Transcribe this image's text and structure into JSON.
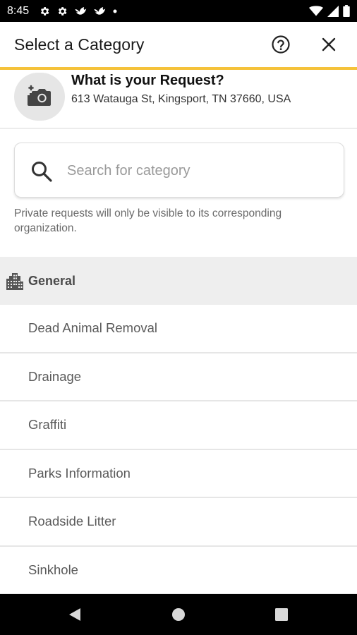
{
  "status_bar": {
    "time": "8:45",
    "left_icons": [
      "gear-icon",
      "gear-icon",
      "bird-icon",
      "bird-icon",
      "dot-icon"
    ],
    "right_icons": [
      "wifi-icon",
      "signal-icon",
      "battery-icon"
    ]
  },
  "header": {
    "title": "Select a Category",
    "help_icon": "help-circle-icon",
    "close_icon": "close-icon",
    "accent_color": "#f5c23a"
  },
  "request": {
    "title": "What is your Request?",
    "address": "613 Watauga St, Kingsport, TN 37660, USA",
    "photo_icon": "add-photo-icon"
  },
  "search": {
    "placeholder": "Search for category",
    "value": ""
  },
  "private_note": "Private requests will only be visible to its corresponding organization.",
  "group": {
    "label": "General",
    "icon": "building-icon"
  },
  "categories": [
    "Dead Animal Removal",
    "Drainage",
    "Graffiti",
    "Parks Information",
    "Roadside Litter",
    "Sinkhole"
  ],
  "nav": {
    "back_icon": "back-triangle-icon",
    "home_icon": "home-circle-icon",
    "recents_icon": "recents-square-icon"
  }
}
